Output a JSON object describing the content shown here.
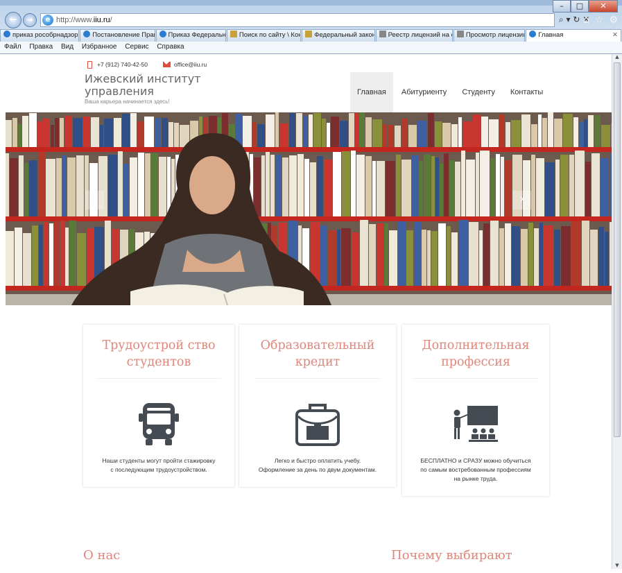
{
  "browser": {
    "url_prefix": "http://www.",
    "url_domain": "iiu.ru",
    "url_suffix": "/",
    "addr_tools": "⌕ ▾ ↻ ✕",
    "tabs": [
      {
        "label": "приказ рособрнадзор...",
        "icon": "ie"
      },
      {
        "label": "Постановление Прави...",
        "icon": "ie"
      },
      {
        "label": "Приказ Федеральной ...",
        "icon": "ie"
      },
      {
        "label": "Поиск по сайту \\ Конс...",
        "icon": "doc"
      },
      {
        "label": "Федеральный закон о...",
        "icon": "doc"
      },
      {
        "label": "Реестр лицензий на о...",
        "icon": "gray"
      },
      {
        "label": "Просмотр лицензии",
        "icon": "gray"
      },
      {
        "label": "Главная",
        "icon": "ie",
        "active": true
      }
    ],
    "menu": [
      "Файл",
      "Правка",
      "Вид",
      "Избранное",
      "Сервис",
      "Справка"
    ]
  },
  "contact": {
    "phone": "+7 (912) 740-42-50",
    "email": "office@iiu.ru"
  },
  "brand": {
    "title_line1": "Ижевский институт",
    "title_line2": "управления",
    "tagline": "Ваша карьера начинается здесь!"
  },
  "nav": [
    "Главная",
    "Абитуриенту",
    "Студенту",
    "Контакты"
  ],
  "carousel": {
    "prev": "‹",
    "next": "›"
  },
  "features": [
    {
      "title_line1": "Трудоустрой ство",
      "title_line2": "студентов",
      "icon": "bus-icon",
      "text_line1": "Наши студенты могут пройти стажировку",
      "text_line2": "с последующим трудоустройством.",
      "text_line3": ""
    },
    {
      "title_line1": "Образовательный",
      "title_line2": "кредит",
      "icon": "briefcase-icon",
      "text_line1": "Легко и быстро оплатить учебу.",
      "text_line2": "Оформление за день по двум документам.",
      "text_line3": ""
    },
    {
      "title_line1": "Дополнительная",
      "title_line2": "профессия",
      "icon": "teacher-board-icon",
      "text_line1": "БЕСПЛАТНО и СРАЗУ можно обучиться",
      "text_line2": "по самым востребованным профессиям",
      "text_line3": "на рынке труда."
    }
  ],
  "sections": {
    "about": "О нас",
    "why": "Почему выбирают"
  },
  "colors": {
    "accent": "#e0857a",
    "icon": "#454b52",
    "brand_gray": "#666666"
  }
}
